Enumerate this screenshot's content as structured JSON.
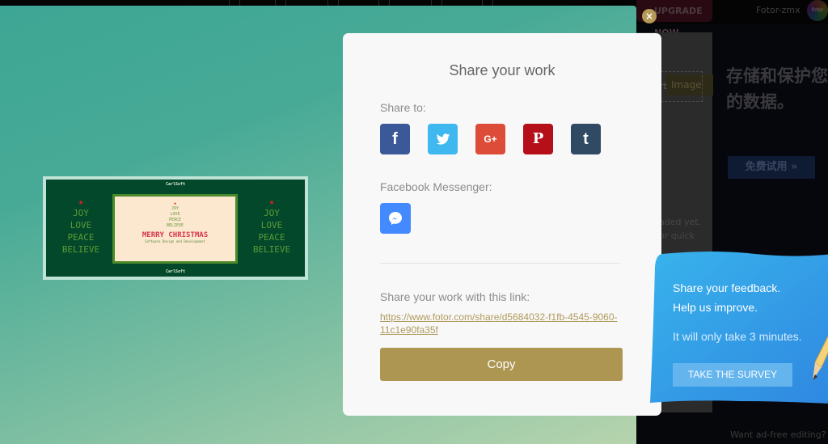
{
  "background_app": {
    "upgrade_label": "UPGRADE NOW",
    "username": "Fotor-zmx",
    "logo_text": "fotor",
    "side_panel": {
      "button_label": "Image",
      "dashed_label": "rt",
      "hint_line1": "aded yet.",
      "hint_line2": "or quick"
    },
    "ad": {
      "title": "存储和保护您的数据。",
      "button_label": "免费试用 »"
    },
    "adfree_text": "Want ad-free editing?"
  },
  "card_preview": {
    "brand": "CarlSoft",
    "side_words": [
      "JOY",
      "LOVE",
      "PEACE",
      "BELIEVE"
    ],
    "center_words": [
      "JOY",
      "LOVE",
      "PEACE",
      "BELIEVE"
    ],
    "center_title": "MERRY CHRISTMAS",
    "center_subtitle": "Software Design and Development"
  },
  "modal": {
    "title": "Share your work",
    "share_to_label": "Share to:",
    "social": [
      {
        "name": "facebook",
        "glyph": "f",
        "color": "#3b5998"
      },
      {
        "name": "twitter",
        "glyph": "",
        "color": "#3fb8ef"
      },
      {
        "name": "google-plus",
        "glyph": "G+",
        "color": "#dd4b39"
      },
      {
        "name": "pinterest",
        "glyph": "P",
        "color": "#b51019"
      },
      {
        "name": "tumblr",
        "glyph": "t",
        "color": "#2f4a62"
      }
    ],
    "messenger_label": "Facebook Messenger:",
    "messenger_color": "#448aff",
    "link_label": "Share your work with this link:",
    "link": "https://www.fotor.com/share/d5684032-f1fb-4545-9060-11c1e90fa35f",
    "copy_label": "Copy",
    "copy_color": "#ad9652"
  },
  "close_label": "×",
  "survey": {
    "heading_line1": "Share your feedback.",
    "heading_line2": "Help us improve.",
    "subtext": "It will only take 3 minutes.",
    "button_label": "TAKE THE SURVEY"
  }
}
